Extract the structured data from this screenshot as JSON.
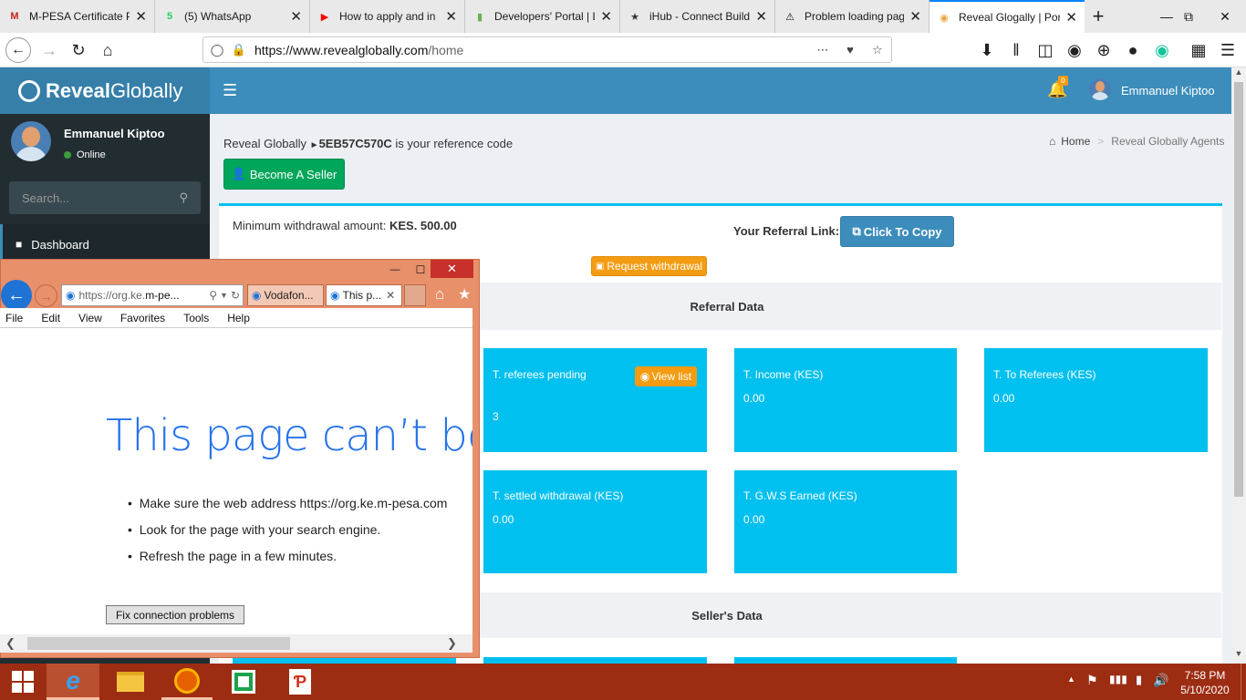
{
  "browser": {
    "tabs": [
      {
        "title": "M-PESA Certificate P",
        "icon": "gmail-icon",
        "fav": "M",
        "color": "#c5221f"
      },
      {
        "title": "(5) WhatsApp",
        "icon": "whatsapp-icon",
        "fav": "5",
        "color": "#25d366"
      },
      {
        "title": "How to apply and in",
        "icon": "youtube-icon",
        "fav": "▶",
        "color": "#ff0000"
      },
      {
        "title": "Developers' Portal | L",
        "icon": "chart-icon",
        "fav": "▮",
        "color": "#6ab04c"
      },
      {
        "title": "iHub - Connect Build",
        "icon": "star-icon",
        "fav": "★",
        "color": "#333"
      },
      {
        "title": "Problem loading pag",
        "icon": "warning-icon",
        "fav": "⚠",
        "color": "#111"
      },
      {
        "title": "Reveal Glogally | Porta",
        "icon": "site-icon",
        "fav": "◉",
        "color": "#e8a23b"
      }
    ],
    "url_host": "https://www.revealglobally.com",
    "url_path": "/home"
  },
  "site": {
    "logo_bold": "Reveal",
    "logo_rest": "Globally",
    "user_name": "Emmanuel Kiptoo",
    "status": "Online",
    "search_placeholder": "Search...",
    "menu": [
      {
        "label": "Dashboard"
      }
    ],
    "notif_count": "0",
    "header_brand": "Reveal Globally",
    "ref_code": "5EB57C570C",
    "ref_suffix": "is your reference code",
    "become_seller": "Become A Seller",
    "breadcrumb_home": "Home",
    "breadcrumb_current": "Reveal Globally Agents",
    "min_withdraw_label": "Minimum withdrawal amount:",
    "min_withdraw_value": "KES. 500.00",
    "referral_link_label": "Your Referral Link:",
    "click_to_copy": "Click To Copy",
    "request_withdrawal": "Request withdrawal",
    "referral_title": "Referral Data",
    "sellers_title": "Seller's Data",
    "kpis": [
      {
        "label": "T. referees pending",
        "value": "3",
        "button": "View list"
      },
      {
        "label": "T. Income (KES)",
        "value": "0.00"
      },
      {
        "label": "T. To Referees (KES)",
        "value": "0.00"
      },
      {
        "label": "T. settled withdrawal (KES)",
        "value": "0.00"
      },
      {
        "label": "T. G.W.S Earned (KES)",
        "value": "0.00"
      }
    ]
  },
  "ie": {
    "url": "https://org.ke.m-pe...",
    "url_host_part": "https://org.ke.",
    "url_bold_part": "m-pe...",
    "tabs": [
      {
        "title": "Vodafon..."
      },
      {
        "title": "This p..."
      }
    ],
    "menu": [
      "File",
      "Edit",
      "View",
      "Favorites",
      "Tools",
      "Help"
    ],
    "headline": "This page can’t be",
    "bullets": [
      "Make sure the web address https://org.ke.m-pesa.com",
      "Look for the page with your search engine.",
      "Refresh the page in a few minutes."
    ],
    "fix_button": "Fix connection problems"
  },
  "taskbar": {
    "time": "7:58 PM",
    "date": "5/10/2020"
  }
}
